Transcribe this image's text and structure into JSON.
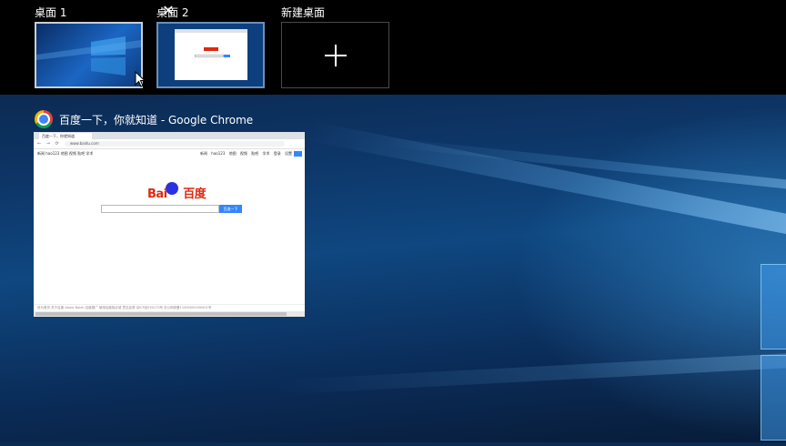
{
  "virtual_desktops": [
    {
      "label": "桌面 1",
      "active": true,
      "has_close": true
    },
    {
      "label": "桌面 2",
      "active": false,
      "has_close": false
    },
    {
      "label": "新建桌面",
      "kind": "add",
      "icon": "plus-icon"
    }
  ],
  "close_glyph": "✕",
  "window": {
    "title": "百度一下，你就知道 - Google Chrome",
    "icon": "chrome-icon",
    "browser": {
      "tab_label": "百度一下，你就知道",
      "url": "www.baidu.com",
      "nav_glyphs": "← → ⟳",
      "top_left_links": "新闻 hao123 地图 视频 贴吧 学术",
      "top_right_links": "新闻 hao123 地图 视频 贴吧 学术 登录 设置",
      "logo": {
        "part1": "Bai",
        "part2": "du",
        "part3": "百度"
      },
      "search_button": "百度一下",
      "footer": "设为首页 关于百度 About Baidu 百度推广 使用百度前必读 意见反馈 京ICP证030173号 京公网安备11000002000001号"
    }
  },
  "colors": {
    "accent_blue": "#3385ff",
    "baidu_red": "#de2910",
    "baidu_blue": "#2932e1"
  }
}
